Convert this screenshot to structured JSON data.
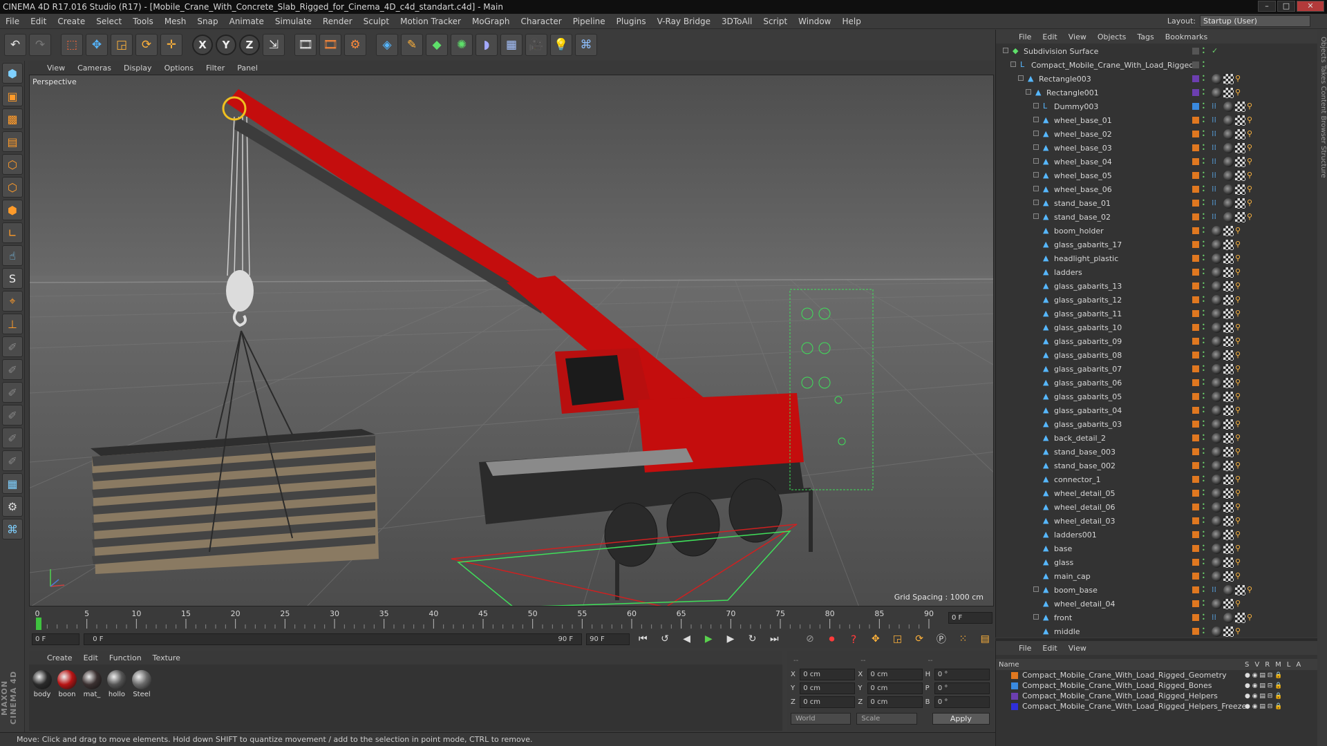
{
  "window": {
    "title": "CINEMA 4D R17.016 Studio (R17) - [Mobile_Crane_With_Concrete_Slab_Rigged_for_Cinema_4D_c4d_standart.c4d] - Main"
  },
  "menu": [
    "File",
    "Edit",
    "Create",
    "Select",
    "Tools",
    "Mesh",
    "Snap",
    "Animate",
    "Simulate",
    "Render",
    "Sculpt",
    "Motion Tracker",
    "MoGraph",
    "Character",
    "Pipeline",
    "Plugins",
    "V-Ray Bridge",
    "3DToAll",
    "Script",
    "Window",
    "Help"
  ],
  "layout": {
    "label": "Layout:",
    "value": "Startup (User)"
  },
  "viewport": {
    "menu": [
      "View",
      "Cameras",
      "Display",
      "Options",
      "Filter",
      "Panel"
    ],
    "label": "Perspective",
    "grid_spacing": "Grid Spacing : 1000 cm",
    "colors": {
      "crane_red": "#c40d0d",
      "boom_dark": "#3a3a3a",
      "ground": "#5b5b5b",
      "helper_green": "#3fe05a"
    }
  },
  "timeline": {
    "ticks": [
      "0",
      "5",
      "10",
      "15",
      "20",
      "25",
      "30",
      "35",
      "40",
      "45",
      "50",
      "55",
      "60",
      "65",
      "70",
      "75",
      "80",
      "85",
      "90"
    ],
    "current_frame": "0 F",
    "start_field": "0 F",
    "range_start": "0 F",
    "range_end": "90 F",
    "end_field": "90 F"
  },
  "materials": {
    "menu": [
      "Create",
      "Edit",
      "Function",
      "Texture"
    ],
    "items": [
      {
        "name": "body",
        "color": "#2a2a2a"
      },
      {
        "name": "boon",
        "color": "#b81414"
      },
      {
        "name": "mat_",
        "color": "#3a3030"
      },
      {
        "name": "hollo",
        "color": "#555555"
      },
      {
        "name": "Steel",
        "color": "#6a6a6a"
      }
    ]
  },
  "coords": {
    "header": [
      "--",
      "--",
      "--"
    ],
    "rows": [
      {
        "a": "X",
        "av": "0 cm",
        "b": "X",
        "bv": "0 cm",
        "c": "H",
        "cv": "0 °"
      },
      {
        "a": "Y",
        "av": "0 cm",
        "b": "Y",
        "bv": "0 cm",
        "c": "P",
        "cv": "0 °"
      },
      {
        "a": "Z",
        "av": "0 cm",
        "b": "Z",
        "bv": "0 cm",
        "c": "B",
        "cv": "0 °"
      }
    ],
    "space": "World",
    "mode": "Scale",
    "apply": "Apply"
  },
  "status": "Move: Click and drag to move elements. Hold down SHIFT to quantize movement / add to the selection in point mode, CTRL to remove.",
  "objects": {
    "menu": [
      "File",
      "Edit",
      "View",
      "Objects",
      "Tags",
      "Bookmarks"
    ],
    "rows": [
      {
        "name": "Subdivision Surface",
        "indent": 0,
        "expand": true,
        "icon": "subdiv",
        "layer": ""
      },
      {
        "name": "Compact_Mobile_Crane_With_Load_Rigged",
        "indent": 1,
        "expand": true,
        "icon": "null",
        "layer": ""
      },
      {
        "name": "Rectangle003",
        "indent": 2,
        "expand": true,
        "icon": "spline",
        "layer": "#6c3fb0"
      },
      {
        "name": "Rectangle001",
        "indent": 3,
        "expand": true,
        "icon": "spline",
        "layer": "#6c3fb0"
      },
      {
        "name": "Dummy003",
        "indent": 4,
        "expand": true,
        "icon": "null",
        "layer": "#3a8ae0"
      },
      {
        "name": "wheel_base_01",
        "indent": 4,
        "expand": true,
        "icon": "poly",
        "layer": "#e07820"
      },
      {
        "name": "wheel_base_02",
        "indent": 4,
        "expand": true,
        "icon": "poly",
        "layer": "#e07820"
      },
      {
        "name": "wheel_base_03",
        "indent": 4,
        "expand": true,
        "icon": "poly",
        "layer": "#e07820"
      },
      {
        "name": "wheel_base_04",
        "indent": 4,
        "expand": true,
        "icon": "poly",
        "layer": "#e07820"
      },
      {
        "name": "wheel_base_05",
        "indent": 4,
        "expand": true,
        "icon": "poly",
        "layer": "#e07820"
      },
      {
        "name": "wheel_base_06",
        "indent": 4,
        "expand": true,
        "icon": "poly",
        "layer": "#e07820"
      },
      {
        "name": "stand_base_01",
        "indent": 4,
        "expand": true,
        "icon": "poly",
        "layer": "#e07820"
      },
      {
        "name": "stand_base_02",
        "indent": 4,
        "expand": true,
        "icon": "poly",
        "layer": "#e07820"
      },
      {
        "name": "boom_holder",
        "indent": 4,
        "expand": false,
        "icon": "poly",
        "layer": "#e07820"
      },
      {
        "name": "glass_gabarits_17",
        "indent": 4,
        "expand": false,
        "icon": "poly",
        "layer": "#e07820"
      },
      {
        "name": "headlight_plastic",
        "indent": 4,
        "expand": false,
        "icon": "poly",
        "layer": "#e07820"
      },
      {
        "name": "ladders",
        "indent": 4,
        "expand": false,
        "icon": "poly",
        "layer": "#e07820"
      },
      {
        "name": "glass_gabarits_13",
        "indent": 4,
        "expand": false,
        "icon": "poly",
        "layer": "#e07820"
      },
      {
        "name": "glass_gabarits_12",
        "indent": 4,
        "expand": false,
        "icon": "poly",
        "layer": "#e07820"
      },
      {
        "name": "glass_gabarits_11",
        "indent": 4,
        "expand": false,
        "icon": "poly",
        "layer": "#e07820"
      },
      {
        "name": "glass_gabarits_10",
        "indent": 4,
        "expand": false,
        "icon": "poly",
        "layer": "#e07820"
      },
      {
        "name": "glass_gabarits_09",
        "indent": 4,
        "expand": false,
        "icon": "poly",
        "layer": "#e07820"
      },
      {
        "name": "glass_gabarits_08",
        "indent": 4,
        "expand": false,
        "icon": "poly",
        "layer": "#e07820"
      },
      {
        "name": "glass_gabarits_07",
        "indent": 4,
        "expand": false,
        "icon": "poly",
        "layer": "#e07820"
      },
      {
        "name": "glass_gabarits_06",
        "indent": 4,
        "expand": false,
        "icon": "poly",
        "layer": "#e07820"
      },
      {
        "name": "glass_gabarits_05",
        "indent": 4,
        "expand": false,
        "icon": "poly",
        "layer": "#e07820"
      },
      {
        "name": "glass_gabarits_04",
        "indent": 4,
        "expand": false,
        "icon": "poly",
        "layer": "#e07820"
      },
      {
        "name": "glass_gabarits_03",
        "indent": 4,
        "expand": false,
        "icon": "poly",
        "layer": "#e07820"
      },
      {
        "name": "back_detail_2",
        "indent": 4,
        "expand": false,
        "icon": "poly",
        "layer": "#e07820"
      },
      {
        "name": "stand_base_003",
        "indent": 4,
        "expand": false,
        "icon": "poly",
        "layer": "#e07820"
      },
      {
        "name": "stand_base_002",
        "indent": 4,
        "expand": false,
        "icon": "poly",
        "layer": "#e07820"
      },
      {
        "name": "connector_1",
        "indent": 4,
        "expand": false,
        "icon": "poly",
        "layer": "#e07820"
      },
      {
        "name": "wheel_detail_05",
        "indent": 4,
        "expand": false,
        "icon": "poly",
        "layer": "#e07820"
      },
      {
        "name": "wheel_detail_06",
        "indent": 4,
        "expand": false,
        "icon": "poly",
        "layer": "#e07820"
      },
      {
        "name": "wheel_detail_03",
        "indent": 4,
        "expand": false,
        "icon": "poly",
        "layer": "#e07820"
      },
      {
        "name": "ladders001",
        "indent": 4,
        "expand": false,
        "icon": "poly",
        "layer": "#e07820"
      },
      {
        "name": "base",
        "indent": 4,
        "expand": false,
        "icon": "poly",
        "layer": "#e07820"
      },
      {
        "name": "glass",
        "indent": 4,
        "expand": false,
        "icon": "poly",
        "layer": "#e07820"
      },
      {
        "name": "main_cap",
        "indent": 4,
        "expand": false,
        "icon": "poly",
        "layer": "#e07820"
      },
      {
        "name": "boom_base",
        "indent": 4,
        "expand": true,
        "icon": "poly",
        "layer": "#e07820"
      },
      {
        "name": "wheel_detail_04",
        "indent": 4,
        "expand": false,
        "icon": "poly",
        "layer": "#e07820"
      },
      {
        "name": "front",
        "indent": 4,
        "expand": true,
        "icon": "poly",
        "layer": "#e07820"
      },
      {
        "name": "middle",
        "indent": 4,
        "expand": false,
        "icon": "poly",
        "layer": "#e07820"
      }
    ]
  },
  "layers": {
    "menu": [
      "File",
      "Edit",
      "View"
    ],
    "header": {
      "name": "Name",
      "cols": [
        "S",
        "V",
        "R",
        "M",
        "L",
        "A"
      ]
    },
    "rows": [
      {
        "name": "Compact_Mobile_Crane_With_Load_Rigged_Geometry",
        "color": "#e07820"
      },
      {
        "name": "Compact_Mobile_Crane_With_Load_Rigged_Bones",
        "color": "#3a8ae0"
      },
      {
        "name": "Compact_Mobile_Crane_With_Load_Rigged_Helpers",
        "color": "#6c3fb0"
      },
      {
        "name": "Compact_Mobile_Crane_With_Load_Rigged_Helpers_Freeze",
        "color": "#2f2fd8"
      }
    ]
  },
  "right_tabs": "Objects  Takes  Content Browser  Structure"
}
